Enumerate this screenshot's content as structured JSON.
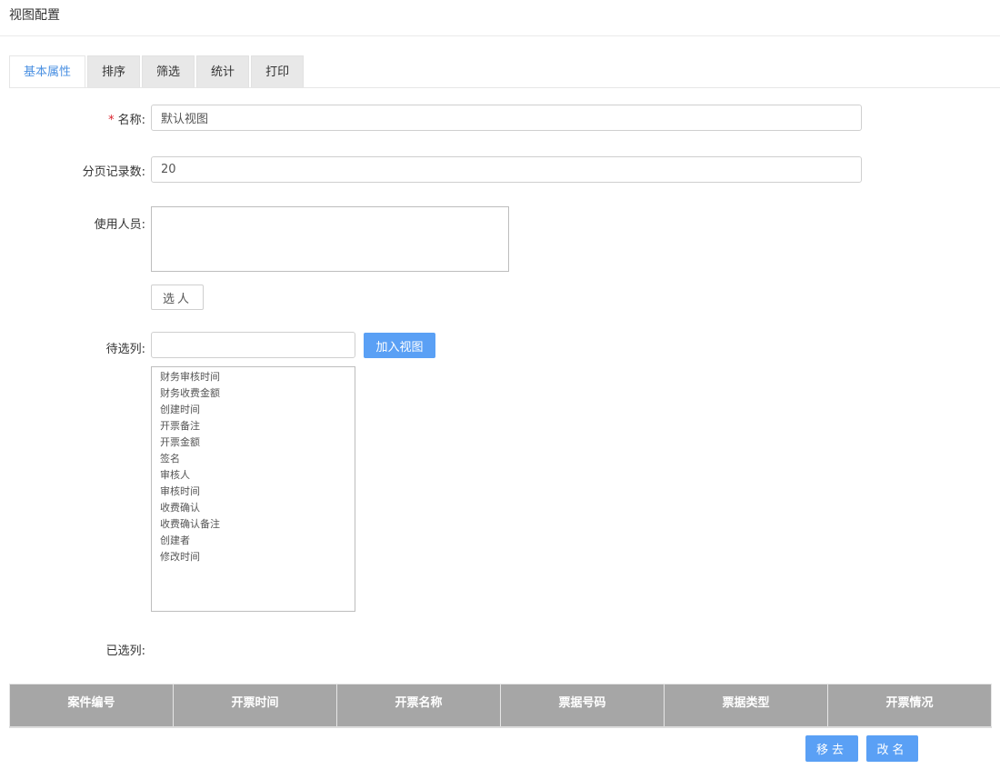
{
  "page": {
    "title": "视图配置"
  },
  "tabs": [
    {
      "label": "基本属性",
      "active": true
    },
    {
      "label": "排序",
      "active": false
    },
    {
      "label": "筛选",
      "active": false
    },
    {
      "label": "统计",
      "active": false
    },
    {
      "label": "打印",
      "active": false
    }
  ],
  "form": {
    "name": {
      "required_mark": "*",
      "label": "名称:",
      "value": "默认视图"
    },
    "page_size": {
      "label": "分页记录数:",
      "value": "20"
    },
    "users": {
      "label": "使用人员:",
      "value": "",
      "select_button": "选人"
    },
    "available": {
      "label": "待选列:",
      "filter_value": "",
      "add_button": "加入视图",
      "options": [
        "财务审核时间",
        "财务收费金额",
        "创建时间",
        "开票备注",
        "开票金额",
        "签名",
        "审核人",
        "审核时间",
        "收费确认",
        "收费确认备注",
        "创建者",
        "修改时间"
      ]
    },
    "selected": {
      "label": "已选列:",
      "columns": [
        "案件编号",
        "开票时间",
        "开票名称",
        "票据号码",
        "票据类型",
        "开票情况"
      ]
    }
  },
  "actions": {
    "remove_button": "移去",
    "rename_button": "改名"
  },
  "colors": {
    "accent": "#5aa0f5",
    "active_tab_text": "#4a90e2",
    "table_header_bg": "#a6a6a6",
    "required": "#d9232d"
  }
}
